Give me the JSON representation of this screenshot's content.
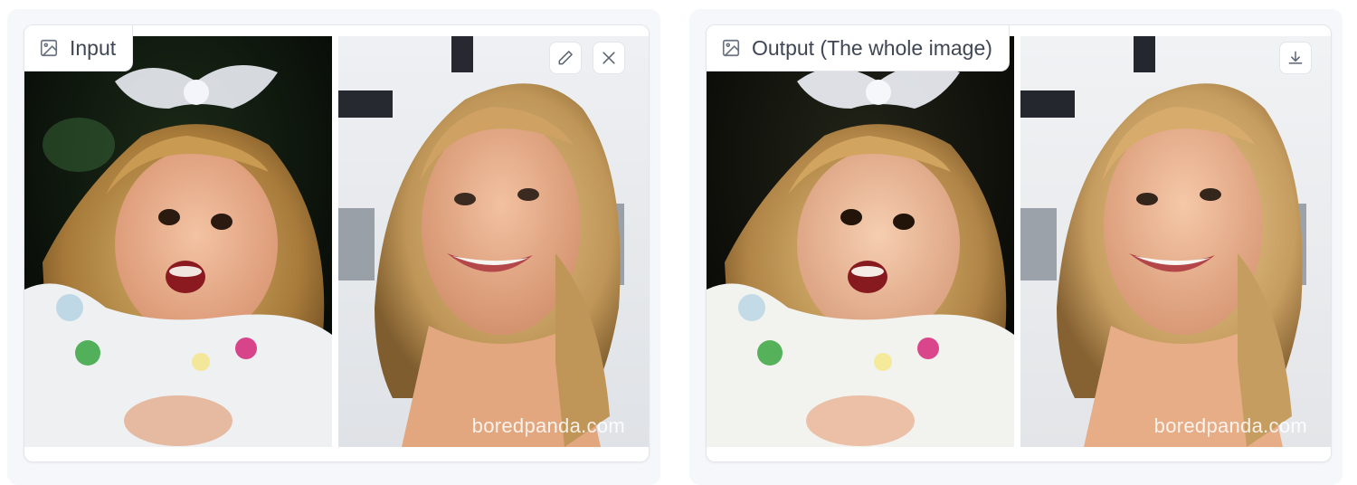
{
  "input_panel": {
    "label": "Input",
    "label_icon": "image-icon",
    "buttons": [
      {
        "icon": "pencil-icon"
      },
      {
        "icon": "close-icon"
      }
    ],
    "watermark": "boredpanda.com"
  },
  "output_panel": {
    "label": "Output (The whole image)",
    "label_icon": "image-icon",
    "buttons": [
      {
        "icon": "download-icon"
      }
    ],
    "watermark": "boredpanda.com"
  },
  "colors": {
    "panel_bg": "#f6f7fa",
    "card_border": "#e3e5ea",
    "label_text": "#3f4654"
  }
}
